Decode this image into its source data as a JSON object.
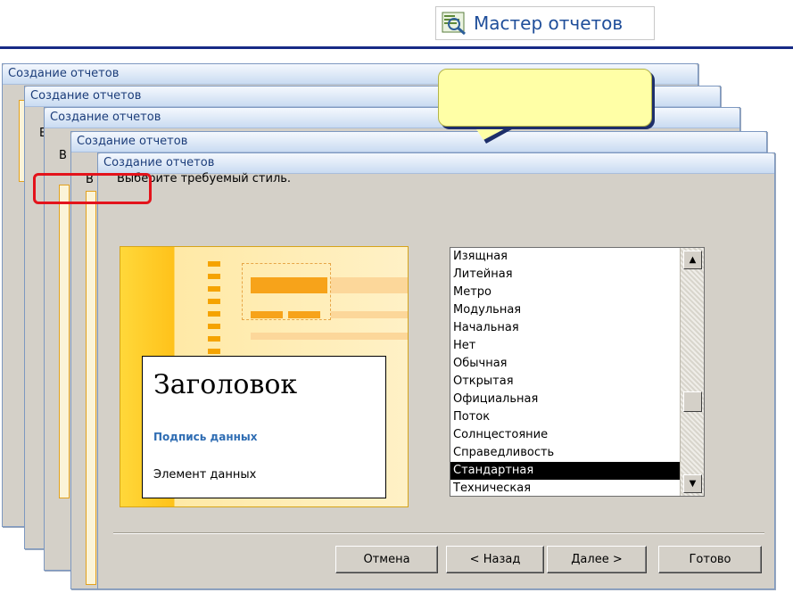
{
  "header": {
    "label": "Мастер отчетов",
    "icon": "wizard-icon"
  },
  "callout": {
    "text": ""
  },
  "windows": {
    "title": "Создание отчетов",
    "w2_clip": "В",
    "w3_clip": "В",
    "w4_clip": "В"
  },
  "dialog": {
    "title": "Создание отчетов",
    "prompt": "Выберите требуемый стиль.",
    "preview": {
      "heading": "Заголовок",
      "caption": "Подпись данных",
      "item": "Элемент данных"
    },
    "styles": [
      "Изящная",
      "Литейная",
      "Метро",
      "Модульная",
      "Начальная",
      "Нет",
      "Обычная",
      "Открытая",
      "Официальная",
      "Поток",
      "Солнцестояние",
      "Справедливость",
      "Стандартная",
      "Техническая"
    ],
    "selected_style": "Стандартная",
    "buttons": {
      "cancel": "Отмена",
      "back": "< Назад",
      "next": "Далее >",
      "finish": "Готово"
    }
  },
  "colors": {
    "accent": "#172a86",
    "highlight": "#e3131b",
    "callout": "#ffffa6"
  }
}
